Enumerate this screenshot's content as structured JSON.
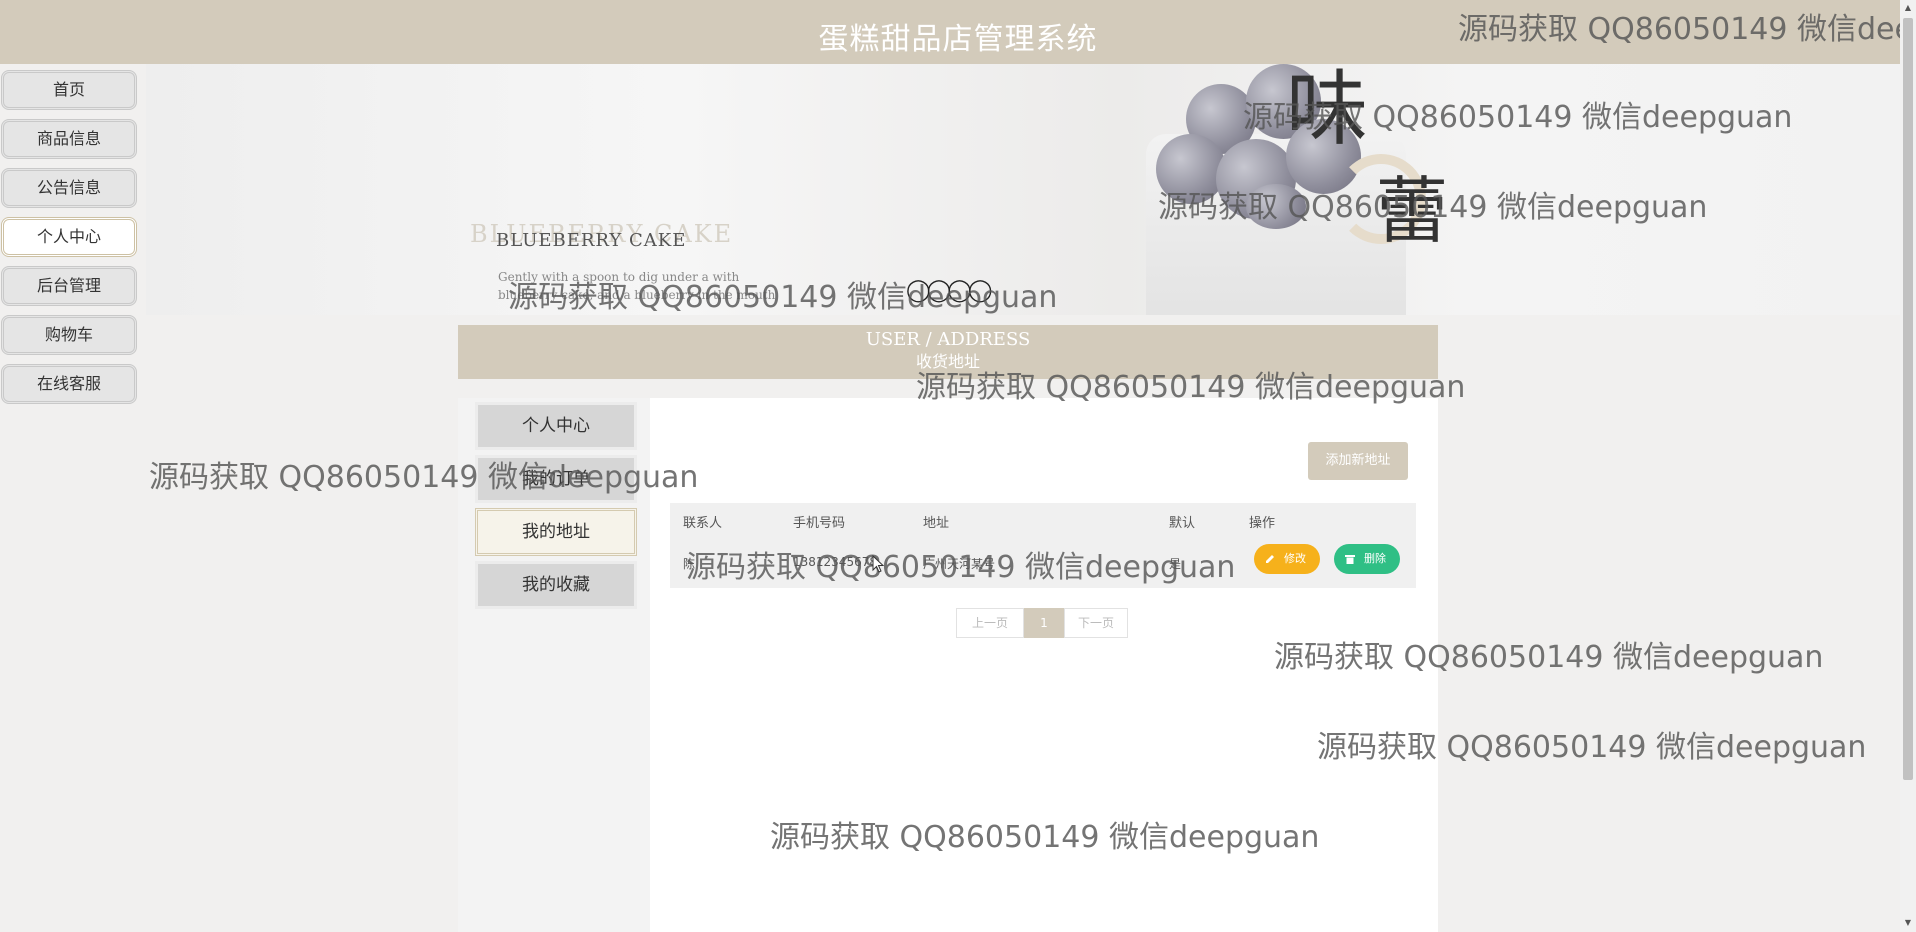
{
  "header": {
    "title": "蛋糕甜品店管理系统"
  },
  "nav": [
    {
      "label": "首页"
    },
    {
      "label": "商品信息"
    },
    {
      "label": "公告信息"
    },
    {
      "label": "个人中心",
      "active": true
    },
    {
      "label": "后台管理"
    },
    {
      "label": "购物车"
    },
    {
      "label": "在线客服"
    }
  ],
  "banner": {
    "tag_faded": "BLUEBERRY CAKE",
    "tag": "BLUEBERRY  CAKE",
    "tag_desc": "Gently with a spoon to dig under a with blueberry cake, and a blueberry in the mouth",
    "glyph_top": "味",
    "glyph_bottom": "蕾"
  },
  "section": {
    "title_en": "USER / ADDRESS",
    "title_cn": "收货地址"
  },
  "submenu": [
    {
      "label": "个人中心"
    },
    {
      "label": "我的订单"
    },
    {
      "label": "我的地址",
      "active": true
    },
    {
      "label": "我的收藏"
    }
  ],
  "add_button": "添加新地址",
  "table": {
    "headers": [
      "联系人",
      "手机号码",
      "地址",
      "默认",
      "操作"
    ],
    "rows": [
      {
        "contact": "陈",
        "phone": "13812345678",
        "address": "广州天河某号",
        "default": "是"
      }
    ],
    "edit_label": "修改",
    "delete_label": "删除"
  },
  "pager": {
    "prev": "上一页",
    "current": "1",
    "next": "下一页"
  },
  "watermark": "源码获取 QQ86050149 微信deepguan",
  "watermark_clipped": "源码获取 QQ86050149 微信deep",
  "colors": {
    "header": "#d3cbbb",
    "edit": "#f6b11b",
    "delete": "#2fbf85"
  }
}
